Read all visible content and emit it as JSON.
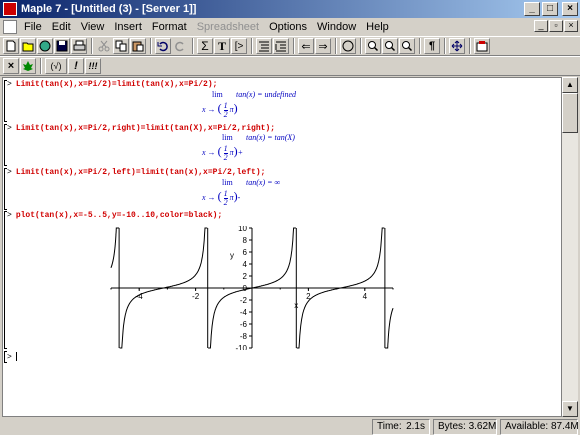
{
  "window": {
    "title": "Maple 7 - [Untitled (3) - [Server 1]]"
  },
  "menubar": {
    "items": [
      {
        "label": "File",
        "disabled": false
      },
      {
        "label": "Edit",
        "disabled": false
      },
      {
        "label": "View",
        "disabled": false
      },
      {
        "label": "Insert",
        "disabled": false
      },
      {
        "label": "Format",
        "disabled": false
      },
      {
        "label": "Spreadsheet",
        "disabled": true
      },
      {
        "label": "Options",
        "disabled": false
      },
      {
        "label": "Window",
        "disabled": false
      },
      {
        "label": "Help",
        "disabled": false
      }
    ]
  },
  "toolbar": {
    "buttons": [
      "new-icon",
      "open-icon",
      "open-url-icon",
      "save-icon",
      "print-icon",
      "cut-icon",
      "copy-icon",
      "paste-icon",
      "undo-icon",
      "redo-icon",
      "sigma-icon",
      "text-mode-icon",
      "prompt-icon",
      "insert-section-icon",
      "collapse-section-icon",
      "back-icon",
      "forward-icon",
      "stop-icon",
      "zoom-100-icon",
      "zoom-150-icon",
      "zoom-200-icon",
      "pilcrow-icon",
      "fit-icon",
      "restart-icon"
    ]
  },
  "toolbar2": {
    "labels": [
      "×",
      "(√)",
      "!",
      "!!!"
    ]
  },
  "worksheet": {
    "commands": [
      "Limit(tan(x),x=Pi/2)=limit(tan(x),x=Pi/2);",
      "Limit(tan(x),x=Pi/2,right)=limit(tan(X),x=Pi/2,right);",
      "Limit(tan(x),x=Pi/2,left)=limit(tan(x),x=Pi/2,left);",
      "plot(tan(x),x=-5..5,y=-10..10,color=black);"
    ],
    "prompt": ">",
    "outputs": [
      {
        "lim": "lim",
        "rhs": "tan(x) = undefined",
        "sub_lhs": "x →",
        "sub_frac_num": "1",
        "sub_frac_den": "2",
        "sub_pi": "π",
        "sub_suffix": ""
      },
      {
        "lim": "lim",
        "rhs": "tan(x) = tan(X)",
        "sub_lhs": "x →",
        "sub_frac_num": "1",
        "sub_frac_den": "2",
        "sub_pi": "π",
        "sub_suffix": "+"
      },
      {
        "lim": "lim",
        "rhs": "tan(x) = ∞",
        "sub_lhs": "x →",
        "sub_frac_num": "1",
        "sub_frac_den": "2",
        "sub_pi": "π",
        "sub_suffix": "-"
      }
    ]
  },
  "plot": {
    "ylabel": "y",
    "xlabel": "x",
    "xticks": [
      "-4",
      "-2",
      "2",
      "4"
    ],
    "yticks": [
      "10",
      "8",
      "6",
      "4",
      "2",
      "0",
      "-2",
      "-4",
      "-6",
      "-8",
      "-10"
    ]
  },
  "chart_data": {
    "type": "line",
    "function": "tan(x)",
    "xlim": [
      -5,
      5
    ],
    "ylim": [
      -10,
      10
    ],
    "xlabel": "x",
    "ylabel": "y",
    "color": "#000000"
  },
  "status": {
    "time_label": "Time:",
    "time_value": "2.1s",
    "bytes_label": "Bytes: 3.62M",
    "available_label": "Available: 87.4M"
  }
}
